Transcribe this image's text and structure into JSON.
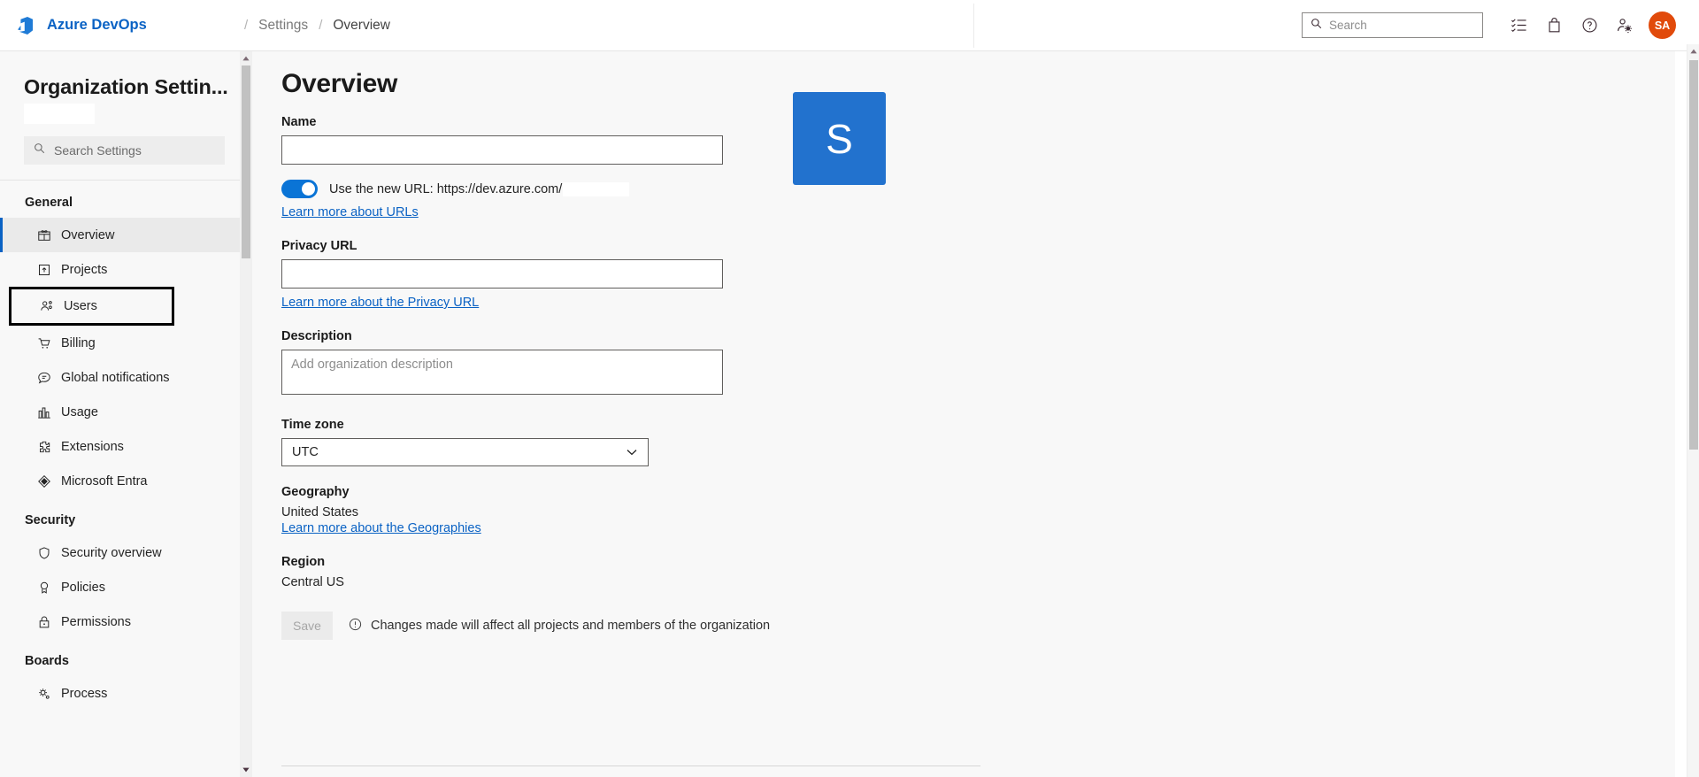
{
  "header": {
    "brand": "Azure DevOps",
    "brand_color": "#0a62c4",
    "breadcrumb": [
      "Settings",
      "Overview"
    ],
    "separator": "/",
    "search_placeholder": "Search",
    "icons": [
      "search-icon",
      "checklist-icon",
      "marketplace-bag-icon",
      "help-question-icon",
      "user-settings-icon"
    ],
    "avatar_initials": "SA",
    "avatar_color": "#e14a0b"
  },
  "sidebar": {
    "title": "Organization Settin...",
    "search_placeholder": "Search Settings",
    "groups": [
      {
        "label": "General",
        "items": [
          {
            "label": "Overview",
            "icon": "overview-grid-icon",
            "active": true,
            "highlighted": false
          },
          {
            "label": "Projects",
            "icon": "projects-box-icon",
            "active": false,
            "highlighted": false
          },
          {
            "label": "Users",
            "icon": "users-people-icon",
            "active": false,
            "highlighted": true
          },
          {
            "label": "Billing",
            "icon": "billing-cart-icon",
            "active": false,
            "highlighted": false
          },
          {
            "label": "Global notifications",
            "icon": "notifications-chat-icon",
            "active": false,
            "highlighted": false
          },
          {
            "label": "Usage",
            "icon": "usage-chart-icon",
            "active": false,
            "highlighted": false
          },
          {
            "label": "Extensions",
            "icon": "extensions-puzzle-icon",
            "active": false,
            "highlighted": false
          },
          {
            "label": "Microsoft Entra",
            "icon": "microsoft-entra-icon",
            "active": false,
            "highlighted": false
          }
        ]
      },
      {
        "label": "Security",
        "items": [
          {
            "label": "Security overview",
            "icon": "shield-icon",
            "active": false,
            "highlighted": false
          },
          {
            "label": "Policies",
            "icon": "policies-ribbon-icon",
            "active": false,
            "highlighted": false
          },
          {
            "label": "Permissions",
            "icon": "lock-icon",
            "active": false,
            "highlighted": false
          }
        ]
      },
      {
        "label": "Boards",
        "items": [
          {
            "label": "Process",
            "icon": "process-gears-icon",
            "active": false,
            "highlighted": false
          }
        ]
      }
    ]
  },
  "main": {
    "page_title": "Overview",
    "name": {
      "label": "Name",
      "value": ""
    },
    "url_toggle": {
      "enabled": true,
      "text": "Use the new URL: https://dev.azure.com/",
      "toggle_color": "#0a74d6",
      "link": "Learn more about URLs"
    },
    "privacy_url": {
      "label": "Privacy URL",
      "value": "",
      "link": "Learn more about the Privacy URL"
    },
    "description": {
      "label": "Description",
      "value": "",
      "placeholder": "Add organization description"
    },
    "time_zone": {
      "label": "Time zone",
      "selected": "UTC"
    },
    "geography": {
      "label": "Geography",
      "value": "United States",
      "link": "Learn more about the Geographies"
    },
    "region": {
      "label": "Region",
      "value": "Central US"
    },
    "save": {
      "label": "Save",
      "disabled": true,
      "note": "Changes made will affect all projects and members of the organization"
    },
    "org_avatar": {
      "letter": "S",
      "color": "#2272ce"
    }
  }
}
